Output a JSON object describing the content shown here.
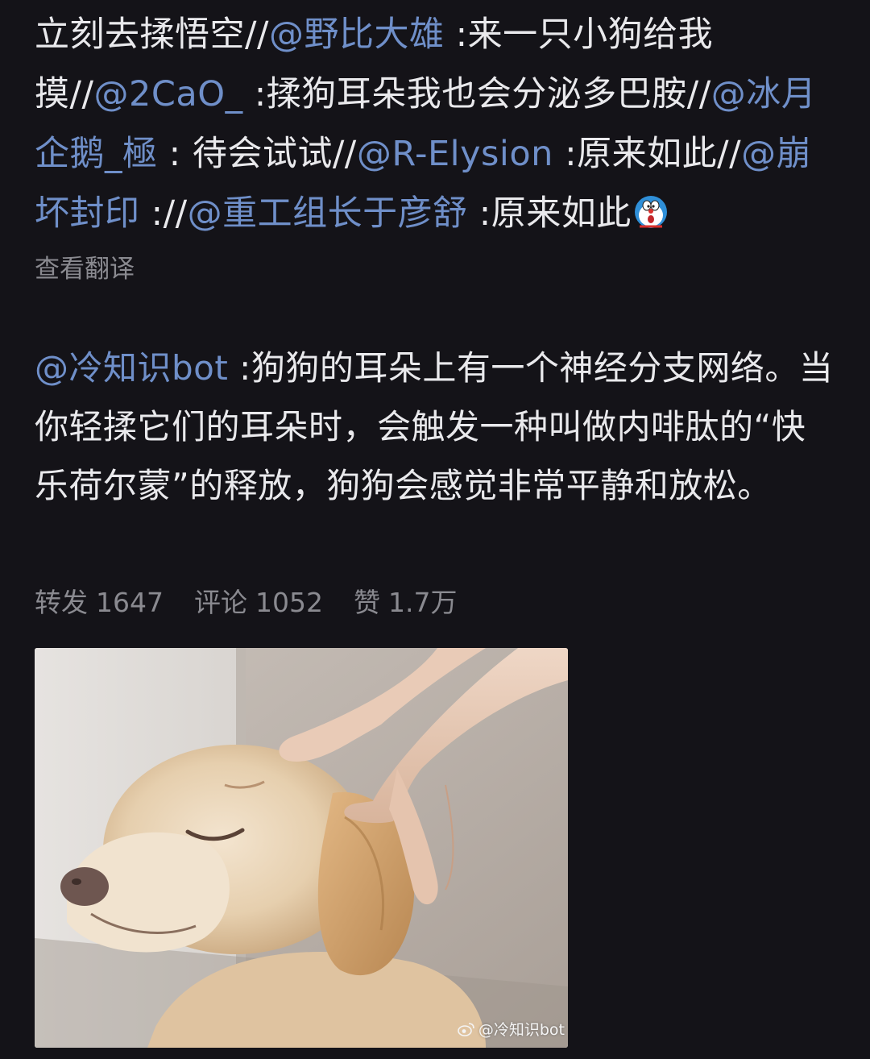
{
  "repost": {
    "segments": [
      {
        "type": "text",
        "text": "立刻去揉悟空//"
      },
      {
        "type": "mention",
        "text": "@野比大雄"
      },
      {
        "type": "text",
        "text": " :来一只小狗给我摸//"
      },
      {
        "type": "mention",
        "text": "@2CaO_"
      },
      {
        "type": "text",
        "text": " :揉狗耳朵我也会分泌多巴胺//"
      },
      {
        "type": "mention",
        "text": "@冰月企鹅_極"
      },
      {
        "type": "text",
        "text": " : 待会试试//"
      },
      {
        "type": "mention",
        "text": "@R-Elysion"
      },
      {
        "type": "text",
        "text": " :原来如此//"
      },
      {
        "type": "mention",
        "text": "@崩坏封印"
      },
      {
        "type": "text",
        "text": " ://"
      },
      {
        "type": "mention",
        "text": "@重工组长于彦舒"
      },
      {
        "type": "text",
        "text": " :原来如此"
      }
    ],
    "emoji_icon": "doraemon-emoji-icon",
    "translate_label": "查看翻译"
  },
  "original": {
    "author": "@冷知识bot",
    "text": " :狗狗的耳朵上有一个神经分支网络。当你轻揉它们的耳朵时，会触发一种叫做内啡肽的“快乐荷尔蒙”的释放，狗狗会感觉非常平静和放松。"
  },
  "stats": {
    "repost_label": "转发",
    "repost_count": "1647",
    "comment_label": "评论",
    "comment_count": "1052",
    "like_label": "赞",
    "like_count": "1.7万"
  },
  "photo": {
    "description_icon": "dog-ear-rub-photo",
    "watermark_text": "@冷知识bot"
  },
  "colors": {
    "background": "#141318",
    "text": "#e9e9ec",
    "mention": "#6f8fc9",
    "muted": "#8a8a90"
  }
}
